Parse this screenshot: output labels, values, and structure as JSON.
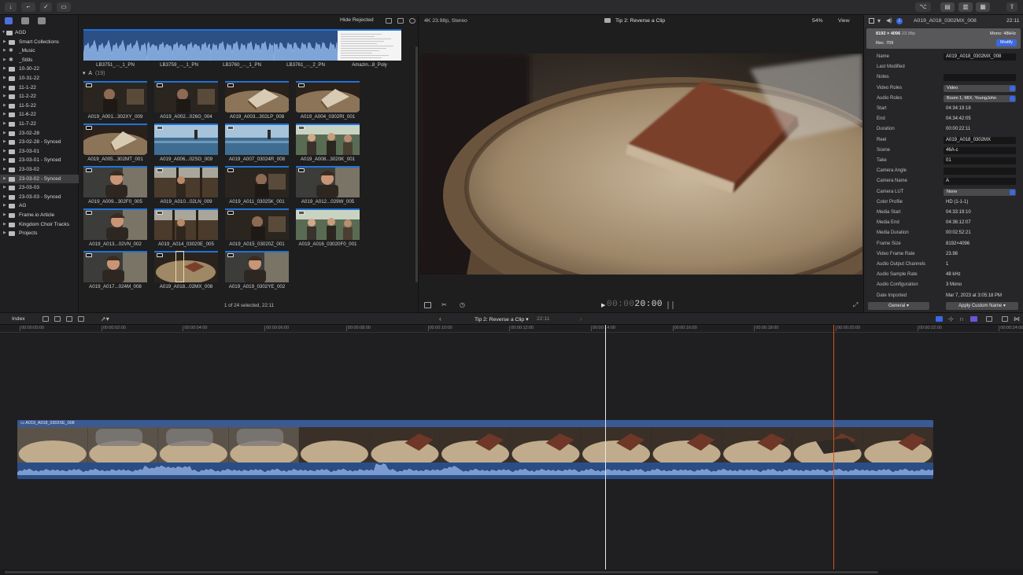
{
  "sidebar": {
    "library": "AGD",
    "items": [
      {
        "label": "Smart Collections",
        "icon": "folder-icon"
      },
      {
        "label": "_Music",
        "icon": "star-icon"
      },
      {
        "label": "_Stills",
        "icon": "star-icon"
      },
      {
        "label": "10-30-22",
        "icon": "event-icon"
      },
      {
        "label": "10-31-22",
        "icon": "event-icon"
      },
      {
        "label": "11-1-22",
        "icon": "event-icon"
      },
      {
        "label": "11-2-22",
        "icon": "event-icon"
      },
      {
        "label": "11-5-22",
        "icon": "event-icon"
      },
      {
        "label": "11-6-22",
        "icon": "event-icon"
      },
      {
        "label": "11-7-22",
        "icon": "event-icon"
      },
      {
        "label": "23-02-28",
        "icon": "event-icon"
      },
      {
        "label": "23-02-28 - Synced",
        "icon": "event-icon"
      },
      {
        "label": "23-03-01",
        "icon": "event-icon"
      },
      {
        "label": "23-03-01 - Synced",
        "icon": "event-icon"
      },
      {
        "label": "23-03-02",
        "icon": "event-icon"
      },
      {
        "label": "23-03-02 - Synced",
        "icon": "event-icon",
        "selected": true
      },
      {
        "label": "23-03-03",
        "icon": "event-icon"
      },
      {
        "label": "23-03-03 - Synced",
        "icon": "event-icon"
      },
      {
        "label": "AG",
        "icon": "event-icon"
      },
      {
        "label": "Frame.io Article",
        "icon": "event-icon"
      },
      {
        "label": "Kingdom Choir Tracks",
        "icon": "event-icon"
      },
      {
        "label": "Projects",
        "icon": "folder-icon"
      }
    ]
  },
  "browser": {
    "filter": "Hide Rejected",
    "top_clips": [
      {
        "name": "LB3751_..._1_PN",
        "kind": "audio"
      },
      {
        "name": "LB3759_..._1_PN",
        "kind": "audio"
      },
      {
        "name": "LB3760_..._1_PN",
        "kind": "audio"
      },
      {
        "name": "LB3761_..._2_PN",
        "kind": "audio"
      },
      {
        "name": "Amazin...8_Poly",
        "kind": "doc"
      }
    ],
    "section": {
      "label": "A",
      "count": "(19)"
    },
    "clips": [
      {
        "name": "A019_A001...302XY_009",
        "scene": "dark"
      },
      {
        "name": "A019_A002...026G_004",
        "scene": "dark"
      },
      {
        "name": "A019_A003...302LP_008",
        "scene": "book"
      },
      {
        "name": "A019_A004_0302RI_001",
        "scene": "book"
      },
      {
        "name": "A019_A005...302MT_001",
        "scene": "book"
      },
      {
        "name": "A019_A006...02SG_009",
        "scene": "sea"
      },
      {
        "name": "A019_A007_03024R_008",
        "scene": "sea"
      },
      {
        "name": "A019_A008...3020K_001",
        "scene": "crowd"
      },
      {
        "name": "A019_A009...302F0_005",
        "scene": "man"
      },
      {
        "name": "A019_A010...02LN_009",
        "scene": "deck"
      },
      {
        "name": "A019_A011_03025K_001",
        "scene": "dark"
      },
      {
        "name": "A019_A012...029W_005",
        "scene": "man"
      },
      {
        "name": "A019_A013...02VN_002",
        "scene": "man"
      },
      {
        "name": "A019_A014_03020E_005",
        "scene": "deck"
      },
      {
        "name": "A019_A015_03020Z_001",
        "scene": "dark"
      },
      {
        "name": "A019_A016_03020F0_001",
        "scene": "crowd"
      },
      {
        "name": "A019_A017...024M_008",
        "scene": "man"
      },
      {
        "name": "A019_A018...02MX_008",
        "scene": "barrel"
      },
      {
        "name": "A019_A019_0302YE_002",
        "scene": "man"
      }
    ],
    "status": "1 of 24 selected, 22:11"
  },
  "viewer": {
    "format": "4K 23.98p, Stereo",
    "title": "Tip 2: Reverse a Clip",
    "zoom": "54%",
    "view": "View",
    "timecode_dim": "00:00",
    "timecode": "20:00"
  },
  "inspector": {
    "clip_name": "A019_A018_0302MX_008",
    "time": "22:11",
    "summary": {
      "size": "8192 × 4096",
      "rate": "23.98p",
      "mono": "Mono: 48kHz",
      "color": "Rec. 709",
      "modify": "Modify"
    },
    "rows": [
      {
        "k": "Name",
        "v": "A019_A018_0302MX_008",
        "type": "field"
      },
      {
        "k": "Last Modified",
        "v": "",
        "type": "text"
      },
      {
        "k": "Notes",
        "v": "",
        "type": "field"
      },
      {
        "k": "Video Roles",
        "v": "Video",
        "type": "pop"
      },
      {
        "k": "Audio Roles",
        "v": "Boom 1, MIX, YoungJohn",
        "type": "pop"
      },
      {
        "k": "Start",
        "v": "04:34:19:18",
        "type": "text"
      },
      {
        "k": "End",
        "v": "04:34:42:05",
        "type": "text"
      },
      {
        "k": "Duration",
        "v": "00:00:22:11",
        "type": "text"
      },
      {
        "k": "Reel",
        "v": "A019_A018_0302MX",
        "type": "field"
      },
      {
        "k": "Scene",
        "v": "46A-c",
        "type": "field"
      },
      {
        "k": "Take",
        "v": "01",
        "type": "field"
      },
      {
        "k": "Camera Angle",
        "v": "",
        "type": "field"
      },
      {
        "k": "Camera Name",
        "v": "A",
        "type": "field"
      },
      {
        "k": "Camera LUT",
        "v": "None",
        "type": "pop"
      },
      {
        "k": "Color Profile",
        "v": "HD (1-1-1)",
        "type": "text"
      },
      {
        "k": "Media Start",
        "v": "04:33:19:10",
        "type": "text"
      },
      {
        "k": "Media End",
        "v": "04:36:12:07",
        "type": "text"
      },
      {
        "k": "Media Duration",
        "v": "00:02:52:21",
        "type": "text"
      },
      {
        "k": "Frame Size",
        "v": "8192×4096",
        "type": "text"
      },
      {
        "k": "Video Frame Rate",
        "v": "23.98",
        "type": "text"
      },
      {
        "k": "Audio Output Channels",
        "v": "1",
        "type": "text"
      },
      {
        "k": "Audio Sample Rate",
        "v": "48 kHz",
        "type": "text"
      },
      {
        "k": "Audio Configuration",
        "v": "3 Mono",
        "type": "text"
      },
      {
        "k": "Date Imported",
        "v": "Mar 7, 2023 at 3:05:18 PM",
        "type": "text"
      }
    ],
    "general_btn": "General",
    "apply_btn": "Apply Custom Name"
  },
  "timeline": {
    "index": "Index",
    "project": "Tip 2: Reverse a Clip",
    "duration": "22:11",
    "ruler": [
      "00:00:00:00",
      "00:00:02:00",
      "00:00:04:00",
      "00:00:06:00",
      "00:00:08:00",
      "00:00:10:00",
      "00:00:12:00",
      "00:00:14:00",
      "00:00:16:00",
      "00:00:18:00",
      "00:00:20:00",
      "00:00:22:00",
      "00:00:24:00"
    ],
    "clip_label": "A019_A018_0302XE_008"
  },
  "colors": {
    "accent": "#3b68e3",
    "clip_bar": "#1f73d8",
    "skimmer": "#d0541d"
  }
}
